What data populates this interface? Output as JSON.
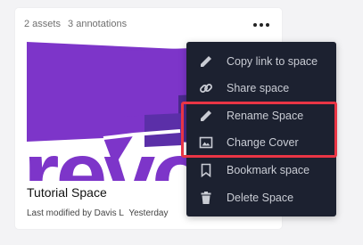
{
  "card": {
    "assets": "2 assets",
    "annotations": "3 annotations",
    "title": "Tutorial Space",
    "modified_prefix": "Last modified by Davis L",
    "modified_when": "Yesterday",
    "cover_logo_text": "revo",
    "more_icon": "more-horizontal-icon"
  },
  "menu": {
    "items": [
      {
        "label": "Copy link to space",
        "icon": "pencil-icon"
      },
      {
        "label": "Share space",
        "icon": "link-icon"
      },
      {
        "label": "Rename Space",
        "icon": "pencil-icon"
      },
      {
        "label": "Change Cover",
        "icon": "image-icon"
      },
      {
        "label": "Bookmark space",
        "icon": "bookmark-icon"
      },
      {
        "label": "Delete Space",
        "icon": "trash-icon"
      }
    ]
  },
  "colors": {
    "menu_bg": "#1c2130",
    "menu_text": "#c9ccd4",
    "highlight": "#e93545",
    "brand_purple": "#7d35c9",
    "brand_purple_dark": "#4a2a8c"
  }
}
